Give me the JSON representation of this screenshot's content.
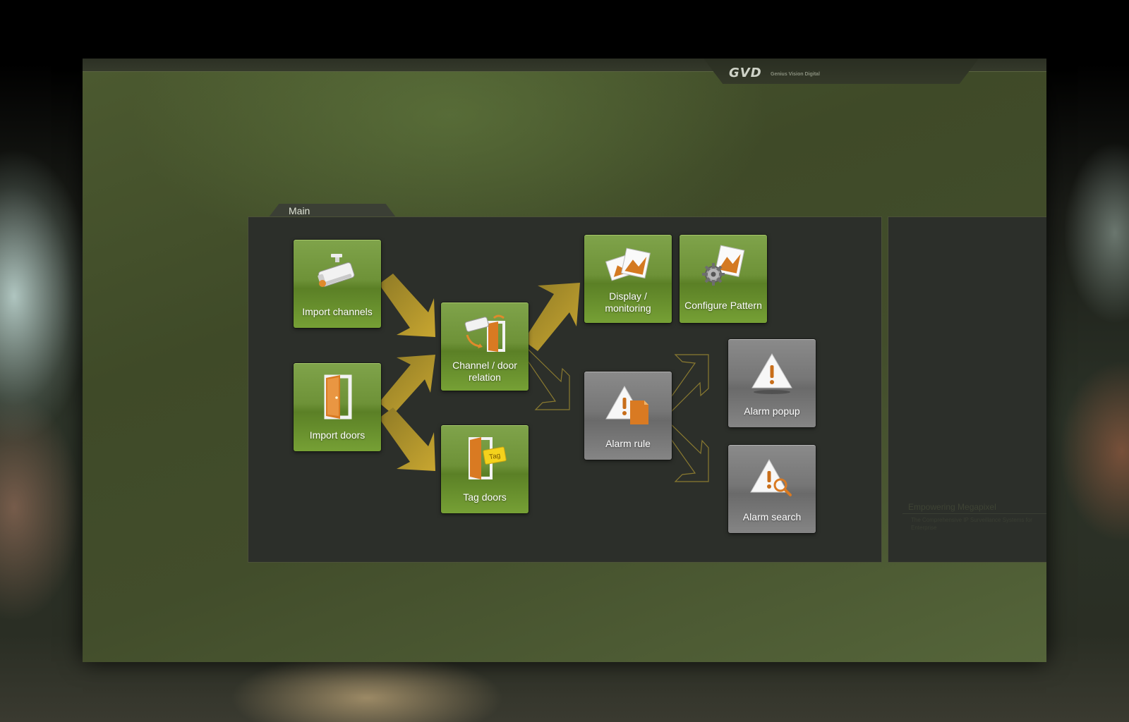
{
  "header": {
    "logo": "GVD",
    "logo_sub": "Genius Vision Digital"
  },
  "main": {
    "tab_label": "Main",
    "tiles": {
      "import_channels": "Import channels",
      "import_doors": "Import doors",
      "channel_door_relation_1": "Channel / door",
      "channel_door_relation_2": "relation",
      "tag_doors": "Tag doors",
      "display_monitoring_1": "Display /",
      "display_monitoring_2": "monitoring",
      "configure_pattern": "Configure Pattern",
      "alarm_rule": "Alarm rule",
      "alarm_popup": "Alarm popup",
      "alarm_search": "Alarm search"
    },
    "tag_badge": "Tag"
  },
  "side": {
    "title": "Empowering Megapixel",
    "text": "The Comprehensive IP Surveillance Systems for Enterprise"
  },
  "colors": {
    "tile_green": "#6e9238",
    "tile_gray": "#767676",
    "arrow_gold": "#b39426"
  }
}
